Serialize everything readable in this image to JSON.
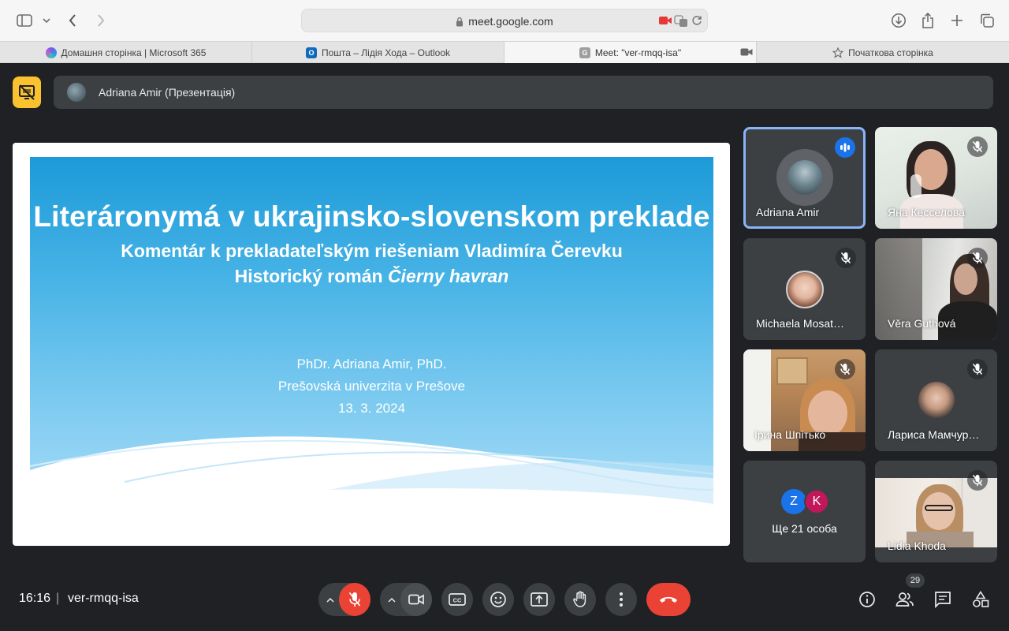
{
  "browser": {
    "url": "meet.google.com",
    "tabs": [
      {
        "label": "Домашня сторінка | Microsoft 365",
        "icon": "microsoft365-icon"
      },
      {
        "label": "Пошта – Лідія Хода – Outlook",
        "icon": "outlook-icon"
      },
      {
        "label": "Meet: \"ver-rmqq-isa\"",
        "icon": "google-icon",
        "favicon_letter": "G",
        "active": true
      },
      {
        "label": "Початкова сторінка",
        "icon": "star-icon"
      }
    ]
  },
  "meet": {
    "presenter_label": "Adriana Amir (Презентація)",
    "slide": {
      "title": "Literáronymá v ukrajinsko-slovenskom preklade",
      "subtitle1": "Komentár k prekladateľským riešeniam Vladimíra Čerevku",
      "subtitle2_plain": "Historický román ",
      "subtitle2_italic": "Čierny havran",
      "author": "PhDr. Adriana Amir, PhD.",
      "university": "Prešovská univerzita v Prešove",
      "date": "13. 3. 2024"
    },
    "participants": [
      {
        "name": "Adriana Amir",
        "state": "speaking"
      },
      {
        "name": "Яна Кесселова",
        "state": "muted"
      },
      {
        "name": "Michaela Mosat…",
        "state": "muted"
      },
      {
        "name": "Věra Guthová",
        "state": "muted"
      },
      {
        "name": "Ірина Шпітько",
        "state": "muted"
      },
      {
        "name": "Лариса Мамчур…",
        "state": "muted"
      },
      {
        "name": "Ще 21 особа",
        "state": "group",
        "initials": [
          "Z",
          "K"
        ]
      },
      {
        "name": "Lidia Khoda",
        "state": "muted"
      }
    ],
    "bottom": {
      "time": "16:16",
      "separator": "|",
      "meeting_code": "ver-rmqq-isa",
      "people_count": "29",
      "captions_label": "CC"
    },
    "colors": {
      "accent_red": "#ea4335",
      "present_yellow": "#f9c22e",
      "speaking_blue": "#8ab4f8"
    }
  }
}
